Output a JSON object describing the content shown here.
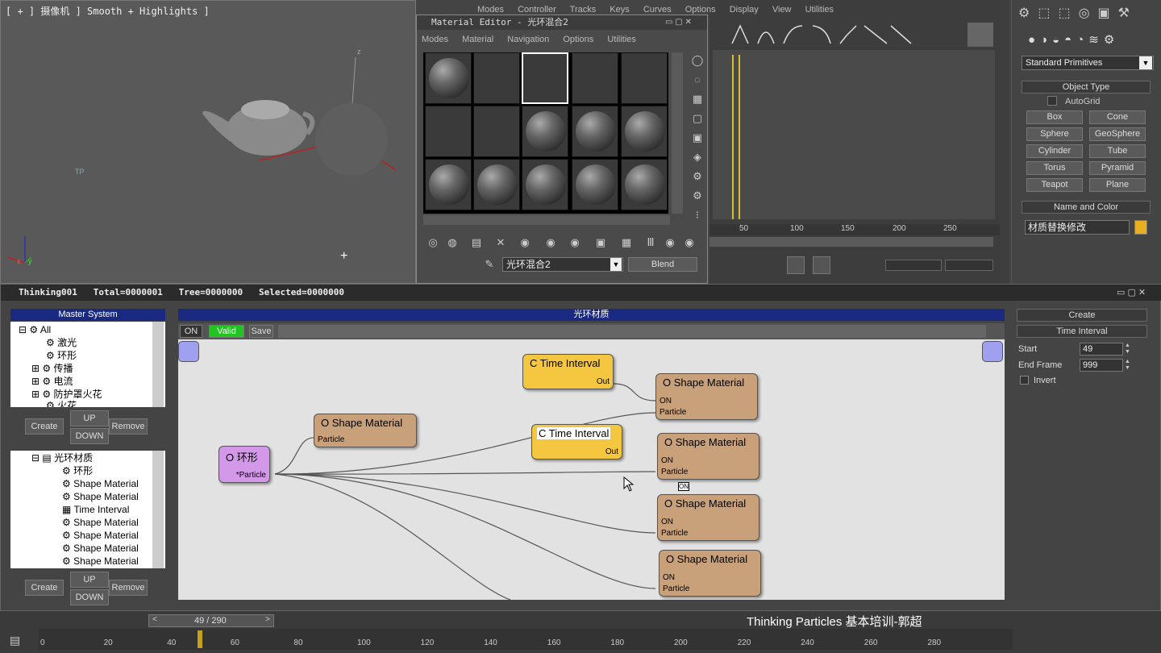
{
  "viewport": {
    "label": "[ + ] 摄像机 ] Smooth + Highlights ]",
    "axis_z": "z",
    "gizmo": [
      "y",
      "x"
    ]
  },
  "material_editor": {
    "title": "Material Editor - 光环混合2",
    "menu": [
      "Modes",
      "Material",
      "Navigation",
      "Options",
      "Utilities"
    ],
    "material_name": "光环混合2",
    "type_button": "Blend"
  },
  "trackview": {
    "menu": [
      "Modes",
      "Controller",
      "Tracks",
      "Keys",
      "Curves",
      "Options",
      "Display",
      "View",
      "Utilities"
    ],
    "ruler": [
      "50",
      "100",
      "150",
      "200",
      "250"
    ]
  },
  "command_panel": {
    "dropdown": "Standard Primitives",
    "object_type_header": "Object Type",
    "autogrid": "AutoGrid",
    "buttons": [
      "Box",
      "Cone",
      "Sphere",
      "GeoSphere",
      "Cylinder",
      "Tube",
      "Torus",
      "Pyramid",
      "Teapot",
      "Plane"
    ],
    "name_color_header": "Name and Color",
    "object_name": "材质替换修改",
    "object_color": "#e8b020"
  },
  "thinking": {
    "title": "Thinking001   Total=0000001   Tree=0000000   Selected=0000000",
    "master_header": "Master System",
    "tree_top": [
      "All",
      "激光",
      "环形",
      "传播",
      "电流",
      "防护罩火花",
      "火花"
    ],
    "btn_create": "Create",
    "btn_up": "UP",
    "btn_down": "DOWN",
    "btn_remove": "Remove",
    "tree_bottom": [
      "光环材质",
      "环形",
      "Shape Material",
      "Shape Material",
      "Time Interval",
      "Shape Material",
      "Shape Material",
      "Shape Material",
      "Shape Material"
    ],
    "group_title": "光环材质",
    "tb_on": "ON",
    "tb_valid": "Valid",
    "tb_save": "Save",
    "nodes": {
      "ring": {
        "title": "O 环形",
        "port": "*Particle"
      },
      "sm1": {
        "title": "O Shape Material",
        "port": "Particle"
      },
      "ti1": {
        "title": "C Time Interval",
        "port": "Out"
      },
      "ti2": {
        "title": "C Time Interval",
        "port": "Out"
      },
      "sm2": {
        "title": "O Shape Material",
        "on": "ON",
        "port": "Particle"
      },
      "sm3": {
        "title": "O Shape Material",
        "on": "ON",
        "port": "Particle"
      },
      "sm4": {
        "title": "O Shape Material",
        "on": "ON",
        "port": "Particle"
      },
      "sm5": {
        "title": "O Shape Material",
        "on": "ON",
        "port": "Particle"
      }
    },
    "on_tag": "ON",
    "right": {
      "create": "Create",
      "time_interval": "Time Interval",
      "start_label": "Start",
      "start_value": "49",
      "end_label": "End Frame",
      "end_value": "999",
      "invert": "Invert"
    }
  },
  "timeline": {
    "frame": "49 / 290",
    "watermark": "Thinking Particles 基本培训-郭超",
    "ticks": [
      "0",
      "20",
      "40",
      "60",
      "80",
      "100",
      "120",
      "140",
      "160",
      "180",
      "200",
      "220",
      "240",
      "260",
      "280"
    ]
  }
}
